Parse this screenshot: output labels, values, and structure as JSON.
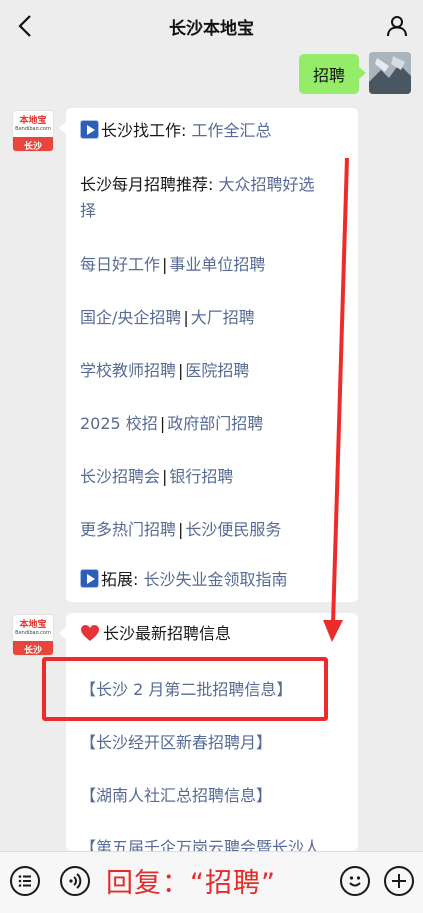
{
  "header": {
    "title": "长沙本地宝"
  },
  "outgoing": {
    "text": "招聘"
  },
  "bot_avatar": {
    "brand": "本地宝",
    "domain": "Bendibao.com",
    "city": "长沙"
  },
  "message1": {
    "line1": {
      "prefix": "长沙找工作: ",
      "link": "工作全汇总"
    },
    "line2": {
      "prefix": "长沙每月招聘推荐: ",
      "link_a": "大众招聘好选",
      "link_b": "择"
    },
    "line3": {
      "left": "每日好工作",
      "sep": "|",
      "right": "事业单位招聘"
    },
    "line4": {
      "left": "国企/央企招聘",
      "sep": "|",
      "right": "大厂招聘"
    },
    "line5": {
      "left": "学校教师招聘",
      "sep": "|",
      "right": "医院招聘"
    },
    "line6": {
      "left": "2025 校招",
      "sep": "|",
      "right": "政府部门招聘"
    },
    "line7": {
      "left": "长沙招聘会",
      "sep": "|",
      "right": "银行招聘"
    },
    "line8": {
      "left": "更多热门招聘",
      "sep": "|",
      "right": "长沙便民服务"
    },
    "line9": {
      "prefix": "拓展: ",
      "link": "长沙失业金领取指南"
    }
  },
  "message2": {
    "title": "长沙最新招聘信息",
    "items": [
      "【长沙 2 月第二批招聘信息】",
      "【长沙经开区新春招聘月】",
      "【湖南人社汇总招聘信息】",
      "【第五届千企万岗云聘会暨长沙人"
    ]
  },
  "bottom_bar": {
    "reply_text": "回复：“招聘”"
  },
  "colors": {
    "link": "#576b95",
    "bubble_out": "#95ec69",
    "highlight": "#ee2b2b",
    "background": "#ededed"
  }
}
